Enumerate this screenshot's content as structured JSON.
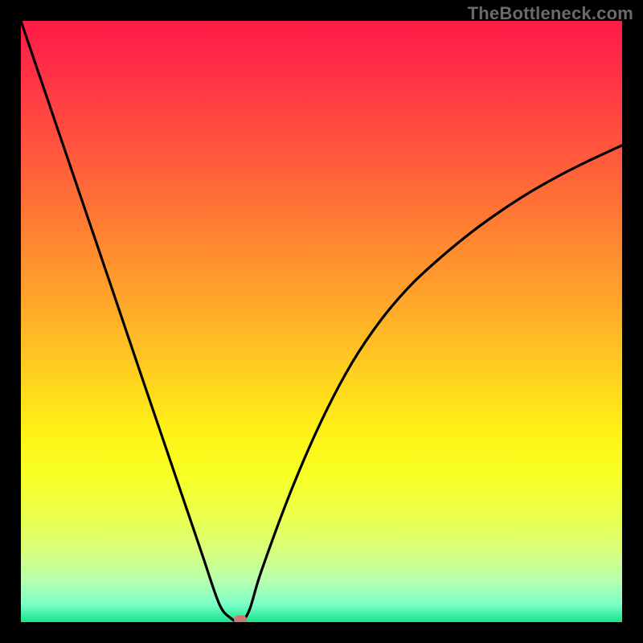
{
  "watermark": "TheBottleneck.com",
  "colors": {
    "frame_bg": "#000000",
    "curve": "#000000",
    "marker": "#c97a74",
    "watermark": "#6a6a6a"
  },
  "chart_data": {
    "type": "line",
    "title": "",
    "xlabel": "",
    "ylabel": "",
    "xlim": [
      0,
      100
    ],
    "ylim": [
      0,
      100
    ],
    "grid": false,
    "legend": false,
    "series": [
      {
        "name": "bottleneck-curve",
        "x": [
          0,
          5,
          10,
          15,
          20,
          25,
          30,
          33,
          35,
          36.5,
          38,
          40,
          45,
          50,
          55,
          60,
          65,
          70,
          75,
          80,
          85,
          90,
          95,
          100
        ],
        "y": [
          100,
          85.3,
          70.6,
          55.9,
          41.1,
          26.4,
          11.7,
          3.0,
          0.6,
          0.0,
          2.0,
          8.5,
          22.0,
          33.5,
          43.0,
          50.4,
          56.2,
          60.8,
          64.9,
          68.5,
          71.7,
          74.5,
          77.0,
          79.3
        ]
      }
    ],
    "optimum_marker": {
      "x": 36.5,
      "y": 0
    },
    "notes": "V-shaped bottleneck curve over a vertical red→yellow→green gradient; minimum (optimal match) near x≈36.5%. No axes or tick labels are shown in the image; values estimated from geometry."
  }
}
